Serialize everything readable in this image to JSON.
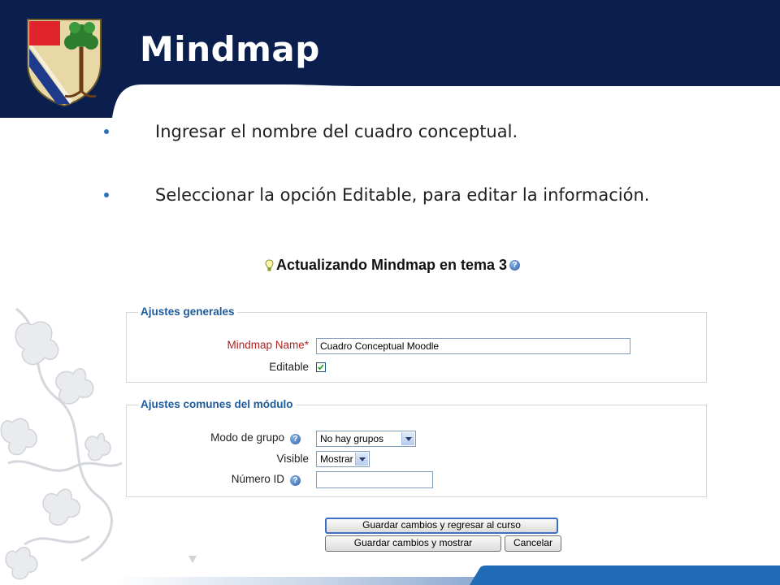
{
  "slide": {
    "title": "Mindmap"
  },
  "bullets": [
    "Ingresar el nombre del cuadro conceptual.",
    "Seleccionar la opción Editable, para editar la información."
  ],
  "form": {
    "heading": "Actualizando Mindmap en tema 3",
    "general": {
      "legend": "Ajustes generales",
      "name_label": "Mindmap Name*",
      "name_value": "Cuadro Conceptual Moodle",
      "editable_label": "Editable",
      "editable_checked": true
    },
    "common": {
      "legend": "Ajustes comunes del módulo",
      "group_mode_label": "Modo de grupo",
      "group_mode_value": "No hay grupos",
      "visible_label": "Visible",
      "visible_value": "Mostrar",
      "id_label": "Número ID",
      "id_value": ""
    },
    "buttons": {
      "save_return": "Guardar cambios y regresar al curso",
      "save_show": "Guardar cambios y mostrar",
      "cancel": "Cancelar"
    }
  },
  "colors": {
    "navy": "#0b1f4e",
    "footer_blue": "#1f6bb6",
    "legend_blue": "#1d5a9c",
    "required_red": "#b22222"
  }
}
